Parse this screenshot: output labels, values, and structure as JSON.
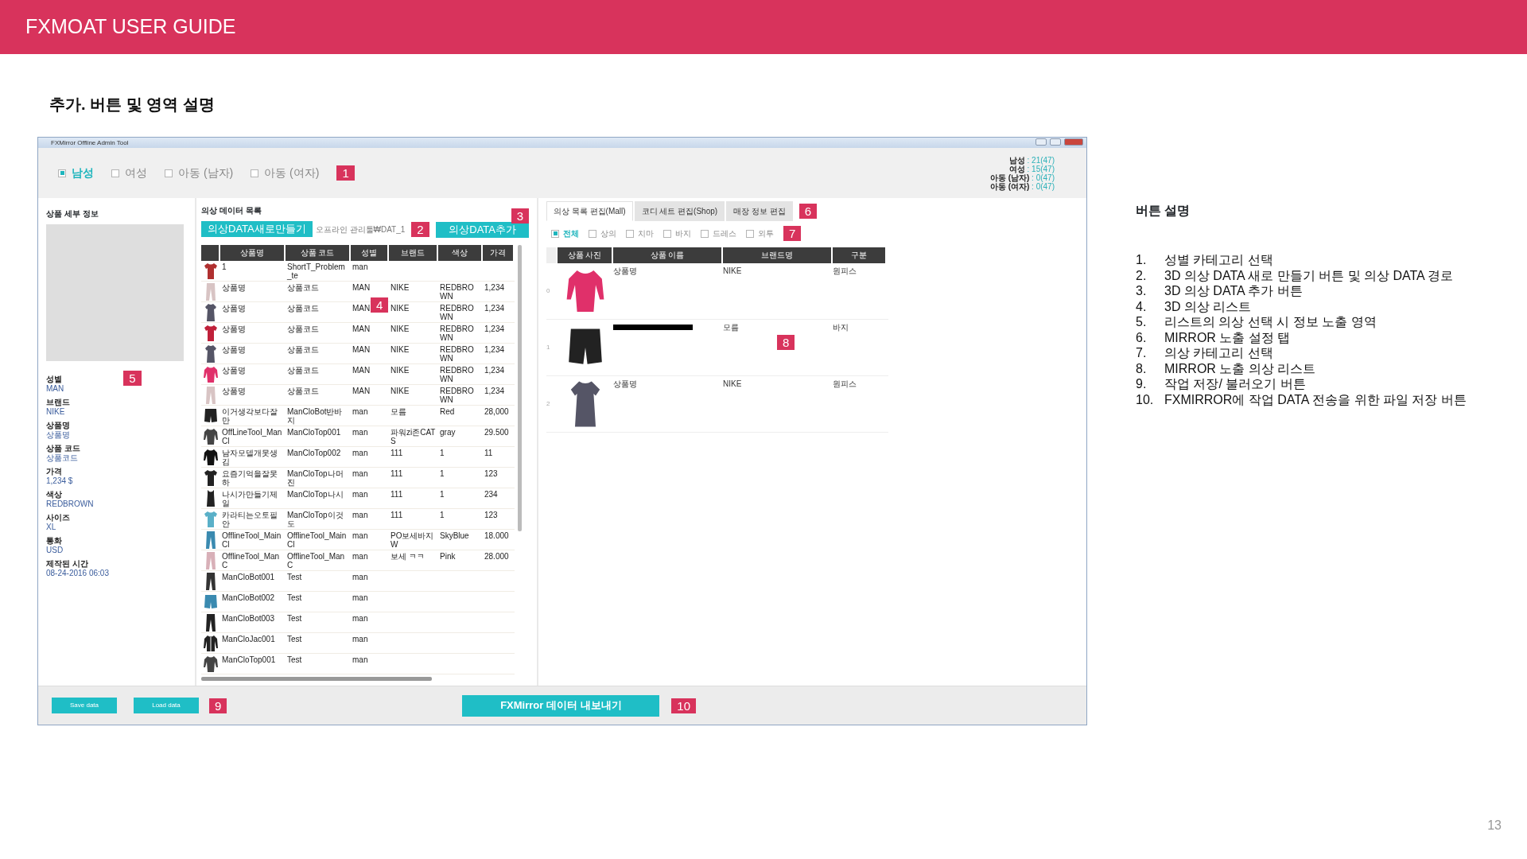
{
  "header": {
    "title": "FXMOAT USER GUIDE"
  },
  "section_title": "추가. 버튼 및 영역 설명",
  "app": {
    "window_title": "FXMirror Offline Admin Tool",
    "genders": [
      {
        "label": "남성",
        "selected": true
      },
      {
        "label": "여성",
        "selected": false
      },
      {
        "label": "아동 (남자)",
        "selected": false
      },
      {
        "label": "아동 (여자)",
        "selected": false
      }
    ],
    "gender_badge": "1",
    "counts": [
      {
        "label": "남성",
        "value": ": 21(47)"
      },
      {
        "label": "여성",
        "value": ": 15(47)"
      },
      {
        "label": "아동 (남자)",
        "value": ": 0(47)"
      },
      {
        "label": "아동 (여자)",
        "value": ": 0(47)"
      }
    ],
    "detail": {
      "title": "상품 세부 정보",
      "badge": "5",
      "fields": [
        {
          "label": "성별",
          "value": "MAN"
        },
        {
          "label": "브랜드",
          "value": "NIKE"
        },
        {
          "label": "상품명",
          "value": "상품명"
        },
        {
          "label": "상품 코드",
          "value": "상품코드"
        },
        {
          "label": "가격",
          "value": "1,234 $"
        },
        {
          "label": "색상",
          "value": "REDBROWN"
        },
        {
          "label": "사이즈",
          "value": "XL"
        },
        {
          "label": "통화",
          "value": "USD"
        },
        {
          "label": "제작된 시간",
          "value": "08-24-2016 06:03"
        }
      ]
    },
    "clothing_list": {
      "title": "의상 데이터 목록",
      "new_button": "의상DATA새로만들기",
      "path": "오프라인 관리툴₩DAT_1",
      "path_badge": "2",
      "add_button": "의상DATA추가",
      "add_badge": "3",
      "list_badge": "4",
      "columns": [
        "상품명",
        "상품 코드",
        "성별",
        "브랜드",
        "색상",
        "가격"
      ],
      "rows": [
        {
          "kind": "tshirt",
          "color": "#b03030",
          "cells": [
            "1",
            "ShortT_Problem_te",
            "man"
          ]
        },
        {
          "kind": "pants",
          "color": "#d8c4c4",
          "cells": [
            "상품명",
            "상품코드",
            "MAN",
            "NIKE",
            "REDBROWN",
            "1,234"
          ]
        },
        {
          "kind": "dress",
          "color": "#555566",
          "cells": [
            "상품명",
            "상품코드",
            "MAN",
            "NIKE",
            "REDBROWN",
            "1,234"
          ]
        },
        {
          "kind": "tshirt",
          "color": "#c0203a",
          "cells": [
            "상품명",
            "상품코드",
            "MAN",
            "NIKE",
            "REDBROWN",
            "1,234"
          ]
        },
        {
          "kind": "dress",
          "color": "#555566",
          "cells": [
            "상품명",
            "상품코드",
            "MAN",
            "NIKE",
            "REDBROWN",
            "1,234"
          ]
        },
        {
          "kind": "longsleeve",
          "color": "#e0306a",
          "cells": [
            "상품명",
            "상품코드",
            "MAN",
            "NIKE",
            "REDBROWN",
            "1,234"
          ]
        },
        {
          "kind": "pants",
          "color": "#d8c4c4",
          "cells": [
            "상품명",
            "상품코드",
            "MAN",
            "NIKE",
            "REDBROWN",
            "1,234"
          ]
        },
        {
          "kind": "shorts",
          "color": "#222222",
          "cells": [
            "이거생각보다잘만",
            "ManCloBot반바지",
            "man",
            "모름",
            "Red",
            "28,000"
          ]
        },
        {
          "kind": "longsleeve",
          "color": "#444444",
          "cells": [
            "OffLineTool_ManCl",
            "ManCloTop001",
            "man",
            "파워zi존CATS",
            "gray",
            "29.500"
          ]
        },
        {
          "kind": "longsleeve",
          "color": "#111111",
          "cells": [
            "남자모델개못생김",
            "ManCloTop002",
            "man",
            "111",
            "1",
            "11"
          ]
        },
        {
          "kind": "tshirt",
          "color": "#222222",
          "cells": [
            "요즘기억을잘못하",
            "ManCloTop나머진",
            "man",
            "111",
            "1",
            "123"
          ]
        },
        {
          "kind": "tank",
          "color": "#222222",
          "cells": [
            "나시가만들기제일",
            "ManCloTop나시",
            "man",
            "111",
            "1",
            "234"
          ]
        },
        {
          "kind": "tshirt",
          "color": "#5ab0c8",
          "cells": [
            "카라티는오토필안",
            "ManCloTop이것도",
            "man",
            "111",
            "1",
            "123"
          ]
        },
        {
          "kind": "pants",
          "color": "#3a8ab0",
          "cells": [
            "OfflineTool_MainCl",
            "OfflineTool_MainCl",
            "man",
            "PO보세바지W",
            "SkyBlue",
            "18.000"
          ]
        },
        {
          "kind": "pants",
          "color": "#d8b0b8",
          "cells": [
            "OfflineTool_ManC",
            "OfflineTool_ManC",
            "man",
            "보세 ㅋㅋ",
            "Pink",
            "28.000"
          ]
        },
        {
          "kind": "pants",
          "color": "#333333",
          "cells": [
            "ManCloBot001",
            "Test",
            "man"
          ]
        },
        {
          "kind": "shorts",
          "color": "#3a8ab0",
          "cells": [
            "ManCloBot002",
            "Test",
            "man"
          ]
        },
        {
          "kind": "pants",
          "color": "#222222",
          "cells": [
            "ManCloBot003",
            "Test",
            "man"
          ]
        },
        {
          "kind": "jacket",
          "color": "#222222",
          "cells": [
            "ManCloJac001",
            "Test",
            "man"
          ]
        },
        {
          "kind": "longsleeve",
          "color": "#444444",
          "cells": [
            "ManCloTop001",
            "Test",
            "man"
          ]
        }
      ]
    },
    "mirror": {
      "tabs": [
        {
          "label": "의상 목록 편집(Mall)",
          "selected": true
        },
        {
          "label": "코디 세트 편집(Shop)",
          "selected": false
        },
        {
          "label": "매장 정보 편집",
          "selected": false
        }
      ],
      "tab_badge": "6",
      "categories": [
        {
          "label": "전체",
          "checked": true
        },
        {
          "label": "상의",
          "checked": false
        },
        {
          "label": "치마",
          "checked": false
        },
        {
          "label": "바지",
          "checked": false
        },
        {
          "label": "드레스",
          "checked": false
        },
        {
          "label": "외투",
          "checked": false
        }
      ],
      "category_badge": "7",
      "columns": [
        "상품 사진",
        "상품 이름",
        "브랜드명",
        "구분"
      ],
      "list_badge": "8",
      "rows": [
        {
          "index": "0",
          "kind": "longsleeve",
          "color": "#e0306a",
          "redacted": false,
          "name": "상품명",
          "brand": "NIKE",
          "type": "원피스"
        },
        {
          "index": "1",
          "kind": "shorts",
          "color": "#222222",
          "redacted": true,
          "brand": "모름",
          "type": "바지"
        },
        {
          "index": "2",
          "kind": "dress",
          "color": "#555566",
          "redacted": false,
          "name": "상품명",
          "brand": "NIKE",
          "type": "원피스"
        }
      ]
    },
    "footer": {
      "save_button": "Save data",
      "load_button": "Load data",
      "file_badge": "9",
      "export_button": "FXMirror 데이터 내보내기",
      "export_badge": "10"
    }
  },
  "guide": {
    "title": "버튼 설명",
    "items": [
      {
        "number": "1.",
        "text": "성별 카테고리 선택"
      },
      {
        "number": "2.",
        "text": "3D 의상 DATA 새로 만들기 버튼 및 의상 DATA 경로"
      },
      {
        "number": "3.",
        "text": "3D 의상 DATA 추가 버튼"
      },
      {
        "number": "4.",
        "text": "3D 의상 리스트"
      },
      {
        "number": "5.",
        "text": "리스트의 의상 선택 시 정보 노출 영역"
      },
      {
        "number": "6.",
        "text": "MIRROR 노출 설정 탭"
      },
      {
        "number": "7.",
        "text": "의상 카테고리 선택"
      },
      {
        "number": "8.",
        "text": "MIRROR 노출 의상 리스트"
      },
      {
        "number": "9.",
        "text": "작업 저장/ 불러오기 버튼"
      },
      {
        "number": "10.",
        "text": "FXMIRROR에 작업 DATA 전송을 위한 파일 저장 버튼"
      }
    ]
  },
  "page_number": "13"
}
